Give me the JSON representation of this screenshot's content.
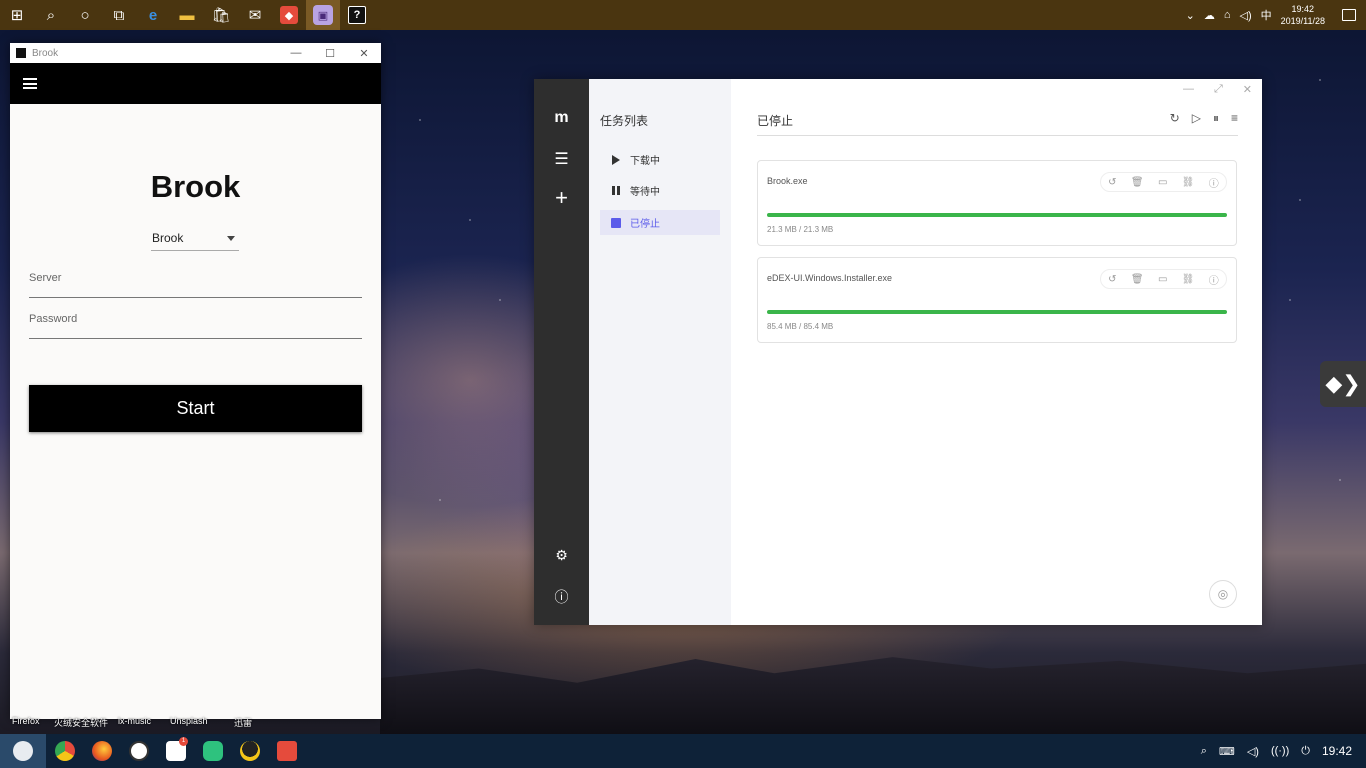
{
  "top_taskbar": {
    "clock_time": "19:42",
    "clock_date": "2019/11/28",
    "ime": "中"
  },
  "brook": {
    "window_title": "Brook",
    "app_title": "Brook",
    "protocol_selected": "Brook",
    "server_placeholder": "Server",
    "password_placeholder": "Password",
    "start_label": "Start"
  },
  "motrix": {
    "nav_title": "任务列表",
    "nav_items": [
      {
        "label": "下载中"
      },
      {
        "label": "等待中"
      },
      {
        "label": "已停止"
      }
    ],
    "main_title": "已停止",
    "tasks": [
      {
        "name": "Brook.exe",
        "size": "21.3 MB / 21.3 MB",
        "progress": 1.0
      },
      {
        "name": "eDEX-UI.Windows.Installer.exe",
        "size": "85.4 MB / 85.4 MB",
        "progress": 1.0
      }
    ],
    "colors": {
      "accent": "#5b5bea",
      "progress": "#3ab54a"
    }
  },
  "desktop_labels": [
    "Firefox",
    "火绒安全软件",
    "lx-music",
    "Unsplash",
    "迅雷"
  ],
  "bottom_taskbar": {
    "clock_time": "19:42",
    "badge_count": "1"
  }
}
